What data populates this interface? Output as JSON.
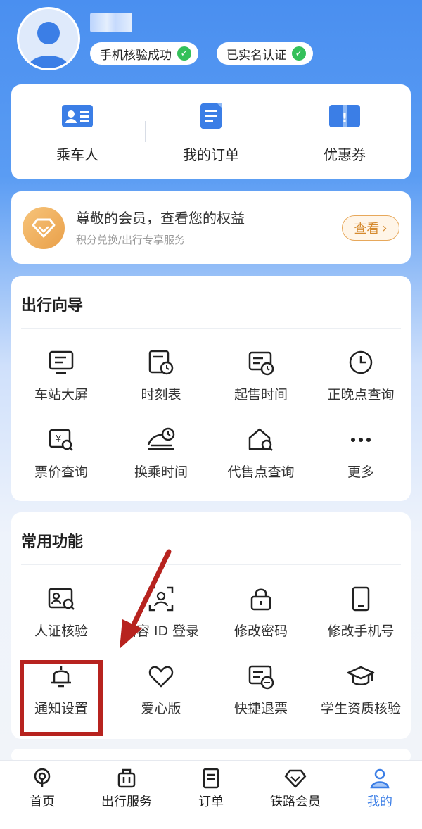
{
  "profile": {
    "phone_verified": "手机核验成功",
    "name_verified": "已实名认证"
  },
  "quick_links": [
    {
      "label": "乘车人",
      "icon": "passenger-icon"
    },
    {
      "label": "我的订单",
      "icon": "orders-icon"
    },
    {
      "label": "优惠券",
      "icon": "coupon-icon"
    }
  ],
  "member": {
    "title": "尊敬的会员，查看您的权益",
    "subtitle": "积分兑换/出行专享服务",
    "view_label": "查看"
  },
  "guide": {
    "title": "出行向导",
    "items": [
      {
        "label": "车站大屏",
        "icon": "station-screen-icon"
      },
      {
        "label": "时刻表",
        "icon": "timetable-icon"
      },
      {
        "label": "起售时间",
        "icon": "sale-time-icon"
      },
      {
        "label": "正晚点查询",
        "icon": "clock-icon"
      },
      {
        "label": "票价查询",
        "icon": "fare-query-icon"
      },
      {
        "label": "换乘时间",
        "icon": "transfer-time-icon"
      },
      {
        "label": "代售点查询",
        "icon": "agency-query-icon"
      },
      {
        "label": "更多",
        "icon": "more-icon"
      }
    ]
  },
  "common": {
    "title": "常用功能",
    "items": [
      {
        "label": "人证核验",
        "icon": "id-verify-icon"
      },
      {
        "label": "面容 ID 登录",
        "icon": "face-id-icon"
      },
      {
        "label": "修改密码",
        "icon": "lock-icon"
      },
      {
        "label": "修改手机号",
        "icon": "phone-icon"
      },
      {
        "label": "通知设置",
        "icon": "bell-icon"
      },
      {
        "label": "爱心版",
        "icon": "heart-icon"
      },
      {
        "label": "快捷退票",
        "icon": "quick-refund-icon"
      },
      {
        "label": "学生资质核验",
        "icon": "graduation-cap-icon"
      }
    ]
  },
  "bottom_nav": [
    {
      "label": "首页",
      "icon": "home-icon",
      "active": false
    },
    {
      "label": "出行服务",
      "icon": "luggage-icon",
      "active": false
    },
    {
      "label": "订单",
      "icon": "order-icon",
      "active": false
    },
    {
      "label": "铁路会员",
      "icon": "diamond-icon",
      "active": false
    },
    {
      "label": "我的",
      "icon": "profile-icon",
      "active": true
    }
  ],
  "colors": {
    "primary_blue": "#3b7ee6",
    "member_gold": "#e9a04a",
    "check_green": "#34c05a",
    "annotation_red": "#b7231f"
  }
}
